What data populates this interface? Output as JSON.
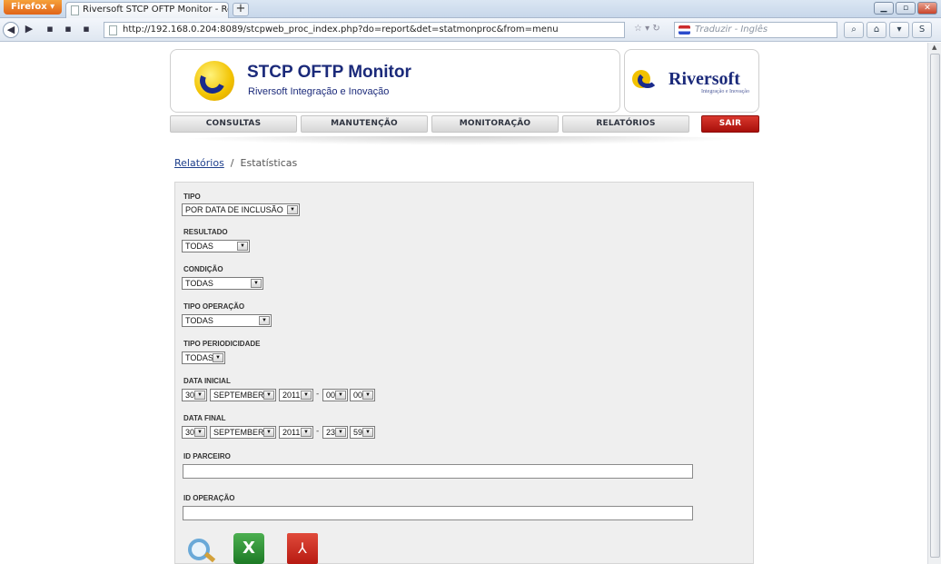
{
  "browser": {
    "menu_label": "Firefox",
    "tab_title": "Riversoft STCP OFTP Monitor - Relatório...",
    "url": "http://192.168.0.204:8089/stcpweb_proc_index.php?do=report&det=statmonproc&from=menu",
    "search_placeholder": "Traduzir - Inglês"
  },
  "header": {
    "app_title": "STCP OFTP Monitor",
    "app_subtitle": "Riversoft Integração e Inovação",
    "brand_name": "Riversoft",
    "brand_tagline": "Integração e Inovação"
  },
  "menu": {
    "items": [
      "CONSULTAS",
      "MANUTENÇÃO",
      "MONITORAÇÃO",
      "RELATÓRIOS"
    ],
    "exit_label": "SAIR"
  },
  "breadcrumb": {
    "link": "Relatórios",
    "separator": "/",
    "current": "Estatísticas"
  },
  "form": {
    "tipo": {
      "label": "TIPO",
      "value": "POR DATA DE INCLUSÃO"
    },
    "resultado": {
      "label": "RESULTADO",
      "value": "TODAS"
    },
    "condicao": {
      "label": "CONDIÇÃO",
      "value": "TODAS"
    },
    "tipo_operacao": {
      "label": "TIPO OPERAÇÃO",
      "value": "TODAS"
    },
    "tipo_periodicidade": {
      "label": "TIPO PERIODICIDADE",
      "value": "TODAS"
    },
    "data_inicial": {
      "label": "DATA INICIAL",
      "day": "30",
      "month": "SEPTEMBER",
      "year": "2011",
      "hour": "00",
      "minute": "00"
    },
    "data_final": {
      "label": "DATA FINAL",
      "day": "30",
      "month": "SEPTEMBER",
      "year": "2011",
      "hour": "23",
      "minute": "59"
    },
    "id_parceiro": {
      "label": "ID PARCEIRO",
      "value": ""
    },
    "id_operacao": {
      "label": "ID OPERAÇÃO",
      "value": ""
    },
    "dash": "-"
  }
}
